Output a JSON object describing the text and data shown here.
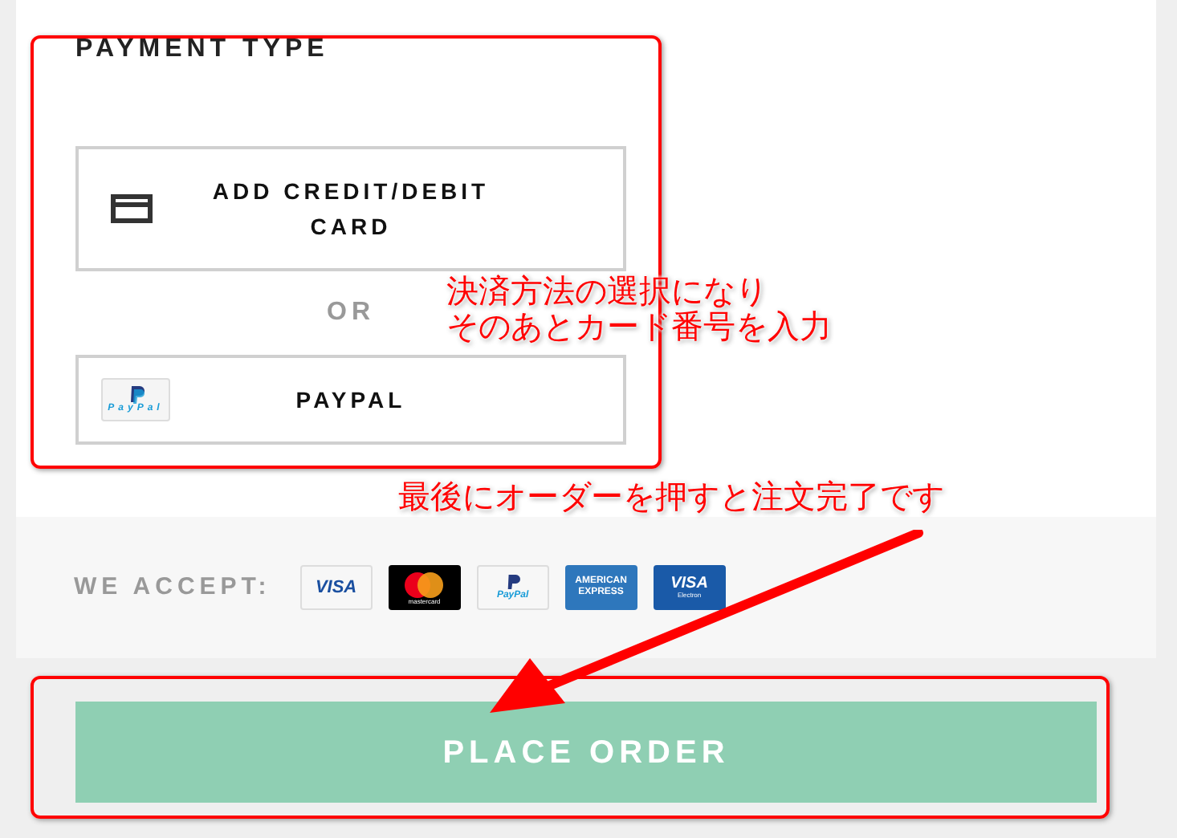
{
  "payment": {
    "title": "PAYMENT TYPE",
    "options": [
      {
        "kind": "card",
        "label": "ADD CREDIT/DEBIT CARD"
      },
      {
        "kind": "paypal",
        "label": "PAYPAL",
        "icon_text": "PayPal"
      }
    ],
    "separator": "OR"
  },
  "accept": {
    "label": "WE ACCEPT:",
    "cards": [
      {
        "kind": "visa",
        "text": "VISA"
      },
      {
        "kind": "mastercard",
        "text": "mastercard"
      },
      {
        "kind": "paypal",
        "text": "PayPal"
      },
      {
        "kind": "amex",
        "text": "AMERICAN EXPRESS"
      },
      {
        "kind": "visa_electron",
        "text": "VISA",
        "subtext": "Electron"
      }
    ]
  },
  "place_order": {
    "label": "PLACE ORDER",
    "disabled": true
  },
  "annotations": [
    {
      "kind": "note",
      "lines": [
        "決済方法の選択になり",
        "そのあとカード番号を入力"
      ]
    },
    {
      "kind": "note",
      "lines": [
        "最後にオーダーを押すと注文完了です"
      ]
    }
  ]
}
